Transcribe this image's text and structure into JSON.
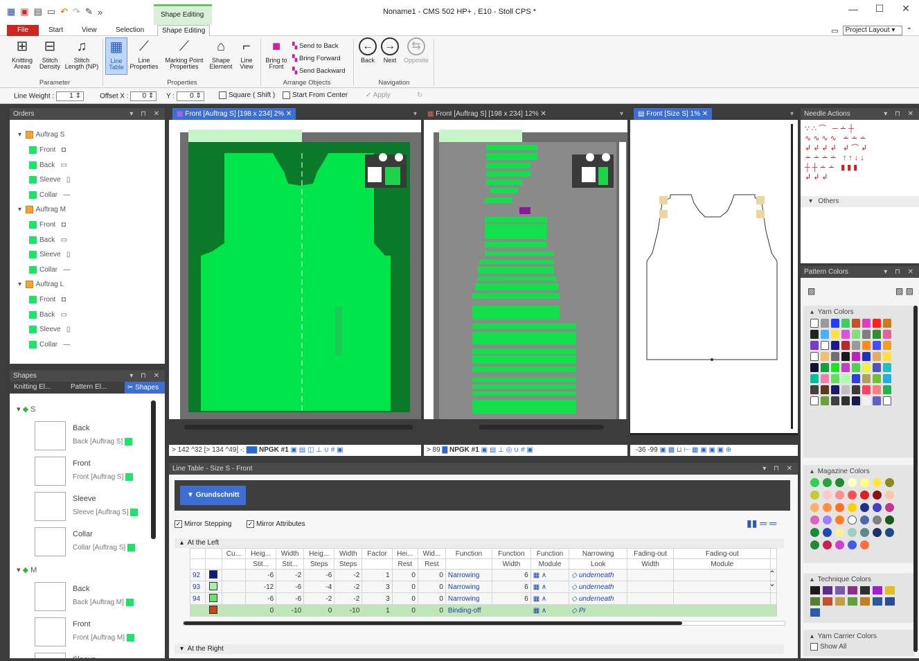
{
  "window": {
    "title": "Noname1 - CMS 502 HP+ , E10 - Stoll CPS *",
    "context_tab": "Shape Editing"
  },
  "tabs": [
    "File",
    "Start",
    "View",
    "Selection",
    "Shape Editing"
  ],
  "project_layout": "Project Layout",
  "ribbon": {
    "buttons": [
      {
        "id": "knit",
        "label": "Knitting\nAreas"
      },
      {
        "id": "density",
        "label": "Stitch\nDensity"
      },
      {
        "id": "length",
        "label": "Stitch\nLength (NP)"
      },
      {
        "id": "linetable",
        "label": "Line\nTable"
      },
      {
        "id": "lineprops",
        "label": "Line\nProperties"
      },
      {
        "id": "mpprops",
        "label": "Marking Point\nProperties"
      },
      {
        "id": "shapeel",
        "label": "Shape\nElement"
      },
      {
        "id": "lineview",
        "label": "Line\nView"
      },
      {
        "id": "bringfront",
        "label": "Bring to\nFront"
      },
      {
        "id": "back",
        "label": "Back"
      },
      {
        "id": "next",
        "label": "Next"
      },
      {
        "id": "opposite",
        "label": "Opposite"
      }
    ],
    "arrange": [
      "Send to Back",
      "Bring Forward",
      "Send Backward"
    ],
    "groups": [
      "Parameter",
      "Properties",
      "Arrange Objects",
      "Navigation"
    ]
  },
  "options": {
    "line_weight_label": "Line Weight :",
    "line_weight": "1",
    "offsetx_label": "Offset X :",
    "offsetx": "0",
    "y_label": "Y :",
    "y": "0",
    "square": "Square ( Shift )",
    "start_center": "Start From Center",
    "apply": "Apply"
  },
  "orders": {
    "title": "Orders",
    "groups": [
      {
        "name": "Auftrag S",
        "items": [
          "Front",
          "Back",
          "Sleeve",
          "Collar"
        ]
      },
      {
        "name": "Auftrag M",
        "items": [
          "Front",
          "Back",
          "Sleeve",
          "Collar"
        ]
      },
      {
        "name": "Auftrag L",
        "items": [
          "Front",
          "Back",
          "Sleeve",
          "Collar"
        ]
      }
    ]
  },
  "shapes": {
    "title": "Shapes",
    "tabs": [
      "Knitting El...",
      "Pattern El...",
      "Shapes"
    ],
    "s_label": "S",
    "m_label": "M",
    "s_items": [
      {
        "name": "Back",
        "sub": "Back [Auftrag S]"
      },
      {
        "name": "Front",
        "sub": "Front [Auftrag S]"
      },
      {
        "name": "Sleeve",
        "sub": "Sleeve [Auftrag S]"
      },
      {
        "name": "Collar",
        "sub": "Collar [Auftrag S]"
      }
    ],
    "m_items": [
      {
        "name": "Back",
        "sub": "Back [Auftrag M]"
      },
      {
        "name": "Front",
        "sub": "Front [Auftrag M]"
      },
      {
        "name": "Sleeve",
        "sub": "Sleeve"
      }
    ]
  },
  "views": [
    {
      "tab": "Front [Auftrag S] [198 x 234] 2%",
      "status": "> 142  ^32    [> 134  ^49] -:",
      "npgk": "NPGK #1"
    },
    {
      "tab": "Front [Auftrag S] [198 x 234] 12%",
      "status": "> 89",
      "npgk": "NPGK #1"
    },
    {
      "tab": "Front [Size S] 1%",
      "status": "-36  -99"
    }
  ],
  "needle_actions": {
    "title": "Needle Actions",
    "others": "Others"
  },
  "pattern_colors": {
    "title": "Pattern Colors",
    "yarn": "Yarn Colors",
    "magazine": "Magazine Colors",
    "technique": "Technique Colors",
    "carrier": "Yarn Carrier Colors",
    "show_all": "Show All",
    "yarn_colors": [
      "#ffffff",
      "#9a9a9a",
      "#1f3cff",
      "#3ccf5a",
      "#c8502a",
      "#e040c0",
      "#ff2020",
      "#cc7a1c",
      "#222222",
      "#44b0ff",
      "#ffe040",
      "#e050e0",
      "#7fe07f",
      "#808080",
      "#2f8f2f",
      "#e060a0",
      "#7a3ad0",
      "#ffffff",
      "#1a1a8a",
      "#b82828",
      "#9a9a9a",
      "#ff8a20",
      "#4a4aff",
      "#f0a020",
      "#ffffff",
      "#f0c070",
      "#707070",
      "#1a1a1a",
      "#c020c0",
      "#2030c0",
      "#e0b060",
      "#ffe040",
      "#101030",
      "#10a040",
      "#20e020",
      "#c040c0",
      "#50d050",
      "#f0f040",
      "#5050c0",
      "#20c0c0",
      "#00c0a0",
      "#f080b0",
      "#60e060",
      "#aaffaa",
      "#3040e0",
      "#b0a060",
      "#70c030",
      "#20b0e0",
      "#404040",
      "#5a3a1a",
      "#1a1a6a",
      "#c0c0c0",
      "#3a3a3a",
      "#ff4060",
      "#ff8080",
      "#1eb84a",
      "#ffffff",
      "#6a9f3a",
      "#404040",
      "#303030",
      "#1a1a4a",
      "#f0f0f0",
      "#6060c0",
      "#ffffff"
    ],
    "magazine_colors": [
      "#30d050",
      "#26a63c",
      "#1f8a30",
      "#ffffc8",
      "#ffff80",
      "#ffe640",
      "#8a8a20",
      "#c8c830",
      "#ffc8c8",
      "#ff9090",
      "#ff5050",
      "#e02020",
      "#8a1414",
      "#ffc8a0",
      "#ffb070",
      "#ff9040",
      "#ff7020",
      "#ffd000",
      "#20308a",
      "#4040c8",
      "#c8348a",
      "#e060c0",
      "#a080ff",
      "#ff8020",
      "#ffffff",
      "#4a6ab0",
      "#808080",
      "#1a5a1a",
      "#1a8a3a",
      "#1f4ab0",
      "#fff0a0",
      "#9ad0c0",
      "#5a8a8a",
      "#1f2f6a",
      "#1f4a8a",
      "#1f8a3a",
      "#c82050",
      "#d040d0",
      "#4060e0",
      "#ff7040"
    ],
    "technique_colors": [
      "#1a1a1a",
      "#5a2f8a",
      "#7a5aaa",
      "#8a2f8a",
      "#303030",
      "#a020d0",
      "#e0c020",
      "#508030",
      "#c05030",
      "#c0a040",
      "#60a040",
      "#c08020",
      "#2a5a9a",
      "#2a4a9a",
      "#2a5aaa"
    ]
  },
  "line_table": {
    "title": "Line Table - Size S - Front",
    "base_button": "Grundschnitt",
    "mirror_stepping": "Mirror Stepping",
    "mirror_attr": "Mirror Attributes",
    "section_left": "At the Left",
    "section_right": "At the Right",
    "headers1": [
      "Cu...",
      "Heig...",
      "Width",
      "Heig...",
      "Width",
      "Factor",
      "Hei...",
      "Wid...",
      "Function",
      "Function",
      "Function",
      "Narrowing",
      "Fading-out",
      "Fading-out"
    ],
    "headers2": [
      "",
      "Stit...",
      "Stit...",
      "Steps",
      "Steps",
      "",
      "Rest",
      "Rest",
      "",
      "Width",
      "Module",
      "Look",
      "Width",
      "Module"
    ],
    "rows": [
      {
        "n": "92",
        "color": "#0a1a8a",
        "h": "-6",
        "w": "-2",
        "hs": "-6",
        "ws": "-2",
        "f": "1",
        "hr": "0",
        "wr": "0",
        "fn": "Narrowing",
        "fw": "6",
        "look": "underneath"
      },
      {
        "n": "93",
        "color": "#aaf0aa",
        "h": "-12",
        "w": "-6",
        "hs": "-4",
        "ws": "-2",
        "f": "3",
        "hr": "0",
        "wr": "0",
        "fn": "Narrowing",
        "fw": "6",
        "look": "underneath"
      },
      {
        "n": "94",
        "color": "#6ae26a",
        "h": "-6",
        "w": "-6",
        "hs": "-2",
        "ws": "-2",
        "f": "3",
        "hr": "0",
        "wr": "0",
        "fn": "Narrowing",
        "fw": "6",
        "look": "underneath"
      },
      {
        "n": "",
        "color": "#c04a1a",
        "h": "0",
        "w": "-10",
        "hs": "0",
        "ws": "-10",
        "f": "1",
        "hr": "0",
        "wr": "0",
        "fn": "Binding-off",
        "fw": "",
        "look": "Pr"
      }
    ]
  }
}
